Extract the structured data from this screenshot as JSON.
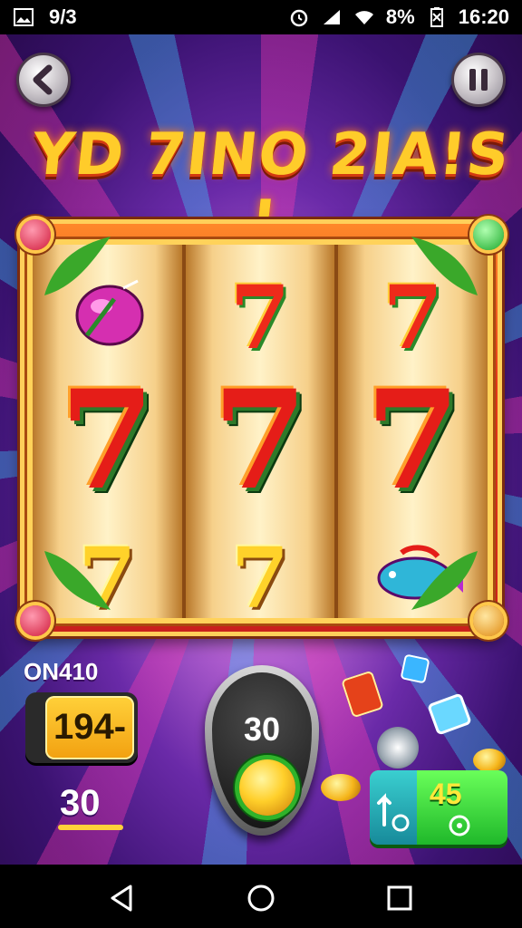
{
  "status_bar": {
    "time_left": "9/3",
    "battery_text": "8%",
    "clock": "16:20",
    "icons": [
      "gallery-icon",
      "alarm-icon",
      "signal-icon",
      "wifi-icon",
      "battery-icon"
    ]
  },
  "game": {
    "title": "YD 7INO 2IA!S !",
    "reels": [
      {
        "top": "fruit",
        "middle": "7",
        "bottom": "7"
      },
      {
        "top": "7",
        "middle": "7",
        "bottom": "7"
      },
      {
        "top": "7",
        "middle": "7",
        "bottom": "fish"
      }
    ],
    "panel_label": "ON410",
    "credit_value": "194-",
    "bet_value": "30",
    "spin_value": "30",
    "green_button_value": "45"
  },
  "colors": {
    "accent": "#ffcc2a",
    "frame_red": "#e3361a",
    "green": "#1fb82a",
    "purple_bg": "#6a2aa8"
  }
}
